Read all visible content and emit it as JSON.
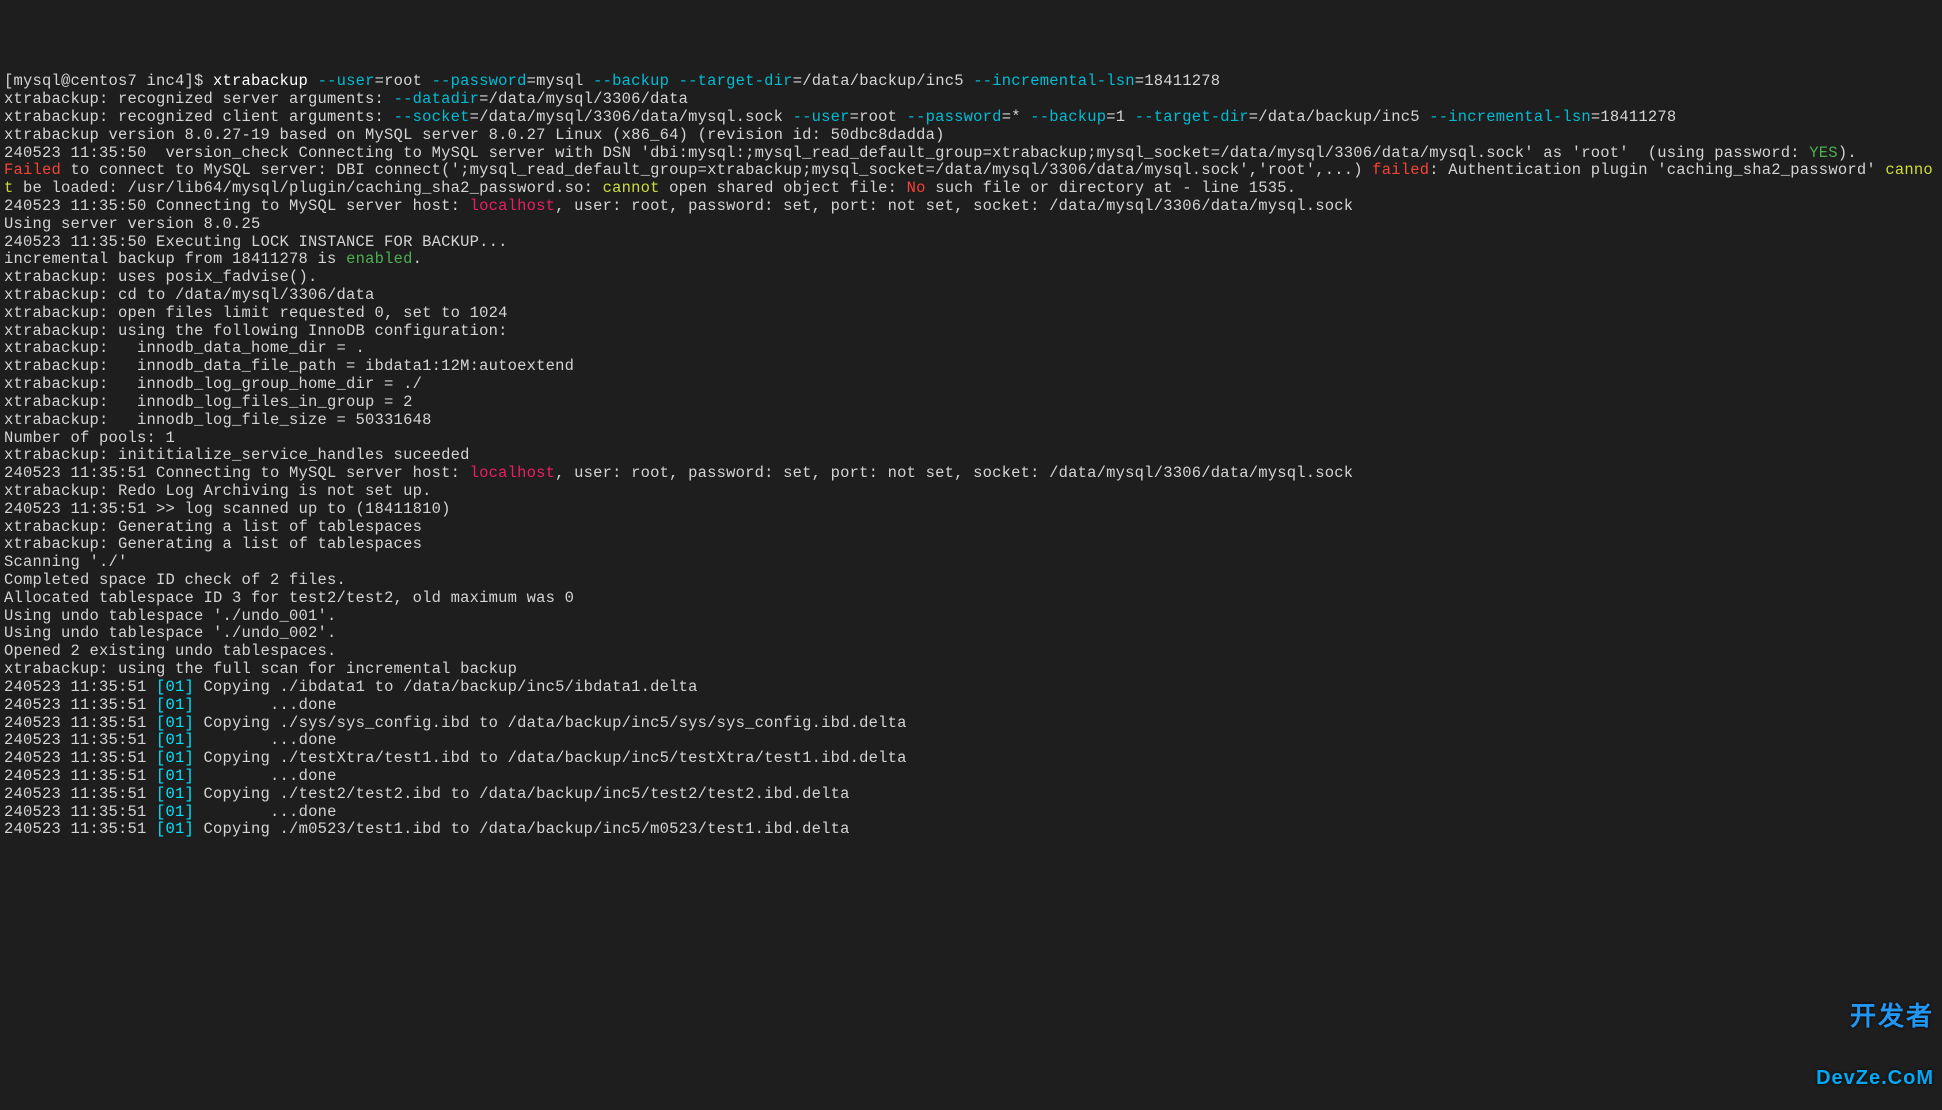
{
  "prompt": {
    "user_host": "[mysql@centos7 inc4]$ ",
    "cmd1": "xtrabackup ",
    "opt_user": "--user",
    "eq_root": "=root ",
    "opt_password": "--password",
    "eq_mysql": "=mysql ",
    "opt_backup": "--backup ",
    "opt_targetdir": "--target-dir",
    "eq_targetdir": "=/data/backup/inc5 ",
    "opt_inclsn": "--incremental-lsn",
    "eq_inclsn": "=18411278"
  },
  "server_args": {
    "prefix": "xtrabackup: recognized server arguments: ",
    "opt_datadir": "--datadir",
    "val_datadir": "=/data/mysql/3306/data "
  },
  "client_args": {
    "prefix": "xtrabackup: recognized client arguments: ",
    "opt_socket": "--socket",
    "val_socket": "=/data/mysql/3306/data/mysql.sock ",
    "opt_user": "--user",
    "val_user": "=root ",
    "opt_password": "--password",
    "val_password": "=* ",
    "opt_backup": "--backup",
    "val_backup": "=1 ",
    "opt_targetdir": "--target-dir",
    "val_targetdir": "=/data/backup/inc5 ",
    "opt_inclsn": "--incremental-lsn",
    "val_inclsn": "=18411278 "
  },
  "version": "xtrabackup version 8.0.27-19 based on MySQL server 8.0.27 Linux (x86_64) (revision id: 50dbc8dadda)",
  "vcheck": {
    "p1": "240523 11:35:50  version_check Connecting to MySQL server with DSN 'dbi:mysql:;mysql_read_default_group=xtrabackup;mysql_socket=/data/mysql/3306/data/mysql.sock' as 'root'  (using password: ",
    "yes": "YES",
    "p2": ")."
  },
  "fail": {
    "failed1": "Failed",
    "p1": " to connect to MySQL server: DBI connect(';mysql_read_default_group=xtrabackup;mysql_socket=/data/mysql/3306/data/mysql.sock','root',...) ",
    "failed2": "failed",
    "p2": ": Authentication plugin 'caching_sha2_password' ",
    "cannot1": "cannot",
    "p3": " be loaded: /usr/lib64/mysql/plugin/caching_sha2_password.so: ",
    "cannot2": "cannot",
    "p4": " open shared object file: ",
    "no": "No",
    "p5": " such file or directory at - line 1535."
  },
  "conn1": {
    "p1": "240523 11:35:50 Connecting to MySQL server host: ",
    "localhost": "localhost",
    "p2": ", user: root, password: set, port: not set, socket: /data/mysql/3306/data/mysql.sock"
  },
  "using_server": "Using server version 8.0.25",
  "lock": "240523 11:35:50 Executing LOCK INSTANCE FOR BACKUP...",
  "incremental": {
    "p1": "incremental backup from 18411278 is ",
    "enabled": "enabled",
    "p2": "."
  },
  "fadvise": "xtrabackup: uses posix_fadvise().",
  "cd": "xtrabackup: cd to /data/mysql/3306/data",
  "files_limit": "xtrabackup: open files limit requested 0, set to 1024",
  "cfg_header": "xtrabackup: using the following InnoDB configuration:",
  "cfg_home": "xtrabackup:   innodb_data_home_dir = .",
  "cfg_filepath": "xtrabackup:   innodb_data_file_path = ibdata1:12M:autoextend",
  "cfg_loghome": "xtrabackup:   innodb_log_group_home_dir = ./",
  "cfg_logfiles": "xtrabackup:   innodb_log_files_in_group = 2",
  "cfg_logsize": "xtrabackup:   innodb_log_file_size = 50331648",
  "pools": "Number of pools: 1",
  "svc": "xtrabackup: inititialize_service_handles suceeded",
  "conn2": {
    "p1": "240523 11:35:51 Connecting to MySQL server host: ",
    "localhost": "localhost",
    "p2": ", user: root, password: set, port: not set, socket: /data/mysql/3306/data/mysql.sock"
  },
  "redo": "xtrabackup: Redo Log Archiving is not set up.",
  "scanned": "240523 11:35:51 >> log scanned up to (18411810)",
  "gen1": "xtrabackup: Generating a list of tablespaces",
  "gen2": "xtrabackup: Generating a list of tablespaces",
  "scanning": "Scanning './'",
  "completed": "Completed space ID check of 2 files.",
  "allocated": "Allocated tablespace ID 3 for test2/test2, old maximum was 0",
  "undo1": "Using undo tablespace './undo_001'.",
  "undo2": "Using undo tablespace './undo_002'.",
  "opened": "Opened 2 existing undo tablespaces.",
  "fullscan": "xtrabackup: using the full scan for incremental backup",
  "copy": [
    {
      "ts": "240523 11:35:51 ",
      "tag": "[01]",
      "msg": " Copying ./ibdata1 to /data/backup/inc5/ibdata1.delta"
    },
    {
      "ts": "240523 11:35:51 ",
      "tag": "[01]",
      "msg": "        ...done"
    },
    {
      "ts": "240523 11:35:51 ",
      "tag": "[01]",
      "msg": " Copying ./sys/sys_config.ibd to /data/backup/inc5/sys/sys_config.ibd.delta"
    },
    {
      "ts": "240523 11:35:51 ",
      "tag": "[01]",
      "msg": "        ...done"
    },
    {
      "ts": "240523 11:35:51 ",
      "tag": "[01]",
      "msg": " Copying ./testXtra/test1.ibd to /data/backup/inc5/testXtra/test1.ibd.delta"
    },
    {
      "ts": "240523 11:35:51 ",
      "tag": "[01]",
      "msg": "        ...done"
    },
    {
      "ts": "240523 11:35:51 ",
      "tag": "[01]",
      "msg": " Copying ./test2/test2.ibd to /data/backup/inc5/test2/test2.ibd.delta"
    },
    {
      "ts": "240523 11:35:51 ",
      "tag": "[01]",
      "msg": "        ...done"
    },
    {
      "ts": "240523 11:35:51 ",
      "tag": "[01]",
      "msg": " Copying ./m0523/test1.ibd to /data/backup/inc5/m0523/test1.ibd.delta"
    }
  ],
  "watermark": {
    "line1": "开发者",
    "line2": "DevZe.CoM"
  }
}
